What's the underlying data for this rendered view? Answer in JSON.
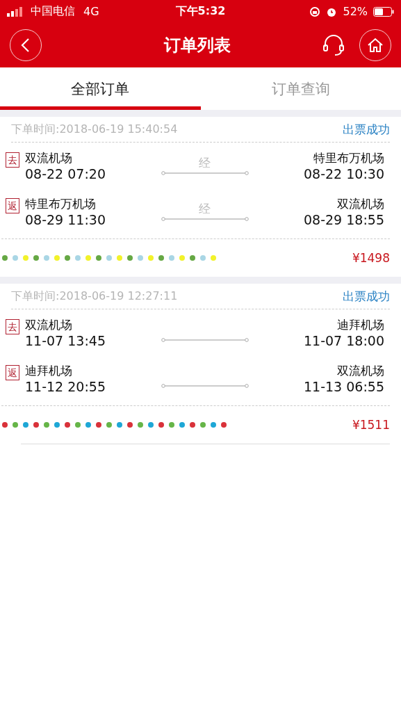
{
  "status_bar": {
    "carrier": "中国电信",
    "network": "4G",
    "time": "下午5:32",
    "battery": "52%"
  },
  "header": {
    "title": "订单列表"
  },
  "tabs": [
    {
      "label": "全部订单",
      "selected": true
    },
    {
      "label": "订单查询",
      "selected": false
    }
  ],
  "orders": [
    {
      "order_time": "下单时间:2018-06-19 15:40:54",
      "status": "出票成功",
      "price": "¥1498",
      "segments": [
        {
          "badge": "去",
          "from": "双流机场",
          "from_time": "08-22 07:20",
          "via": "经",
          "to": "特里布万机场",
          "to_time": "08-22 10:30"
        },
        {
          "badge": "返",
          "from": "特里布万机场",
          "from_time": "08-29 11:30",
          "via": "经",
          "to": "双流机场",
          "to_time": "08-29 18:55"
        }
      ]
    },
    {
      "order_time": "下单时间:2018-06-19 12:27:11",
      "status": "出票成功",
      "price": "¥1511",
      "segments": [
        {
          "badge": "去",
          "from": "双流机场",
          "from_time": "11-07 13:45",
          "to": "迪拜机场",
          "to_time": "11-07 18:00"
        },
        {
          "badge": "返",
          "from": "迪拜机场",
          "from_time": "11-12 20:55",
          "to": "双流机场",
          "to_time": "11-13 06:55"
        }
      ]
    }
  ]
}
